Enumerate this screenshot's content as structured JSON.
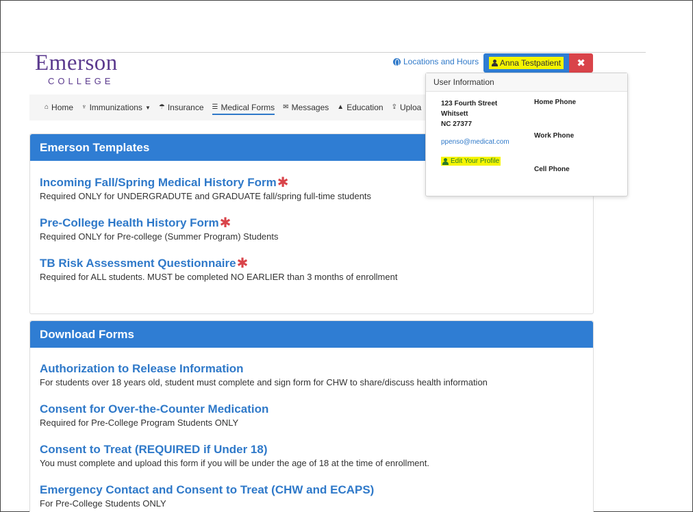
{
  "logo": {
    "main": "Emerson",
    "sub": "COLLEGE"
  },
  "header": {
    "locations_link": "Locations and Hours",
    "user_button": "Anna Testpatient",
    "close_label": "✖"
  },
  "nav": {
    "items": [
      {
        "label": "Home",
        "icon": "home-icon"
      },
      {
        "label": "Immunizations",
        "icon": "syringe-icon"
      },
      {
        "label": "Insurance",
        "icon": "umbrella-icon"
      },
      {
        "label": "Medical Forms",
        "icon": "list-icon"
      },
      {
        "label": "Messages",
        "icon": "envelope-icon"
      },
      {
        "label": "Education",
        "icon": "bell-icon"
      },
      {
        "label": "Uploa",
        "icon": "upload-icon"
      }
    ]
  },
  "popover": {
    "title": "User Information",
    "address_line1": "123 Fourth Street",
    "address_line2": "Whitsett",
    "address_line3": "NC 27377",
    "email": "ppenso@medicat.com",
    "edit_profile": "Edit Your Profile",
    "home_phone": "Home Phone",
    "work_phone": "Work Phone",
    "cell_phone": "Cell Phone"
  },
  "templates": {
    "heading": "Emerson Templates",
    "items": [
      {
        "title": "Incoming Fall/Spring Medical History Form",
        "desc": "Required ONLY for UNDERGRADUTE and GRADUATE fall/spring full-time students"
      },
      {
        "title": "Pre-College Health History Form",
        "desc": "Required ONLY for Pre-college (Summer Program) Students"
      },
      {
        "title": "TB Risk Assessment Questionnaire",
        "desc": "Required for ALL students. MUST be completed NO EARLIER than 3 months of enrollment"
      }
    ]
  },
  "downloads": {
    "heading": "Download Forms",
    "items": [
      {
        "title": "Authorization to Release Information",
        "desc": "For students over 18 years old, student must complete and sign form for CHW to share/discuss health information"
      },
      {
        "title": "Consent for Over-the-Counter Medication",
        "desc": "Required for Pre-College Program Students ONLY"
      },
      {
        "title": "Consent to Treat (REQUIRED if Under 18)",
        "desc": "You must complete and upload this form if you will be under the age of 18 at the time of enrollment."
      },
      {
        "title": "Emergency Contact and Consent to Treat (CHW and ECAPS)",
        "desc": "For Pre-College Students ONLY"
      }
    ]
  },
  "colors": {
    "brand_purple": "#5b3a8e",
    "primary_blue": "#2f7dd3",
    "danger_red": "#d9444a",
    "highlight_yellow": "#f5f500"
  }
}
